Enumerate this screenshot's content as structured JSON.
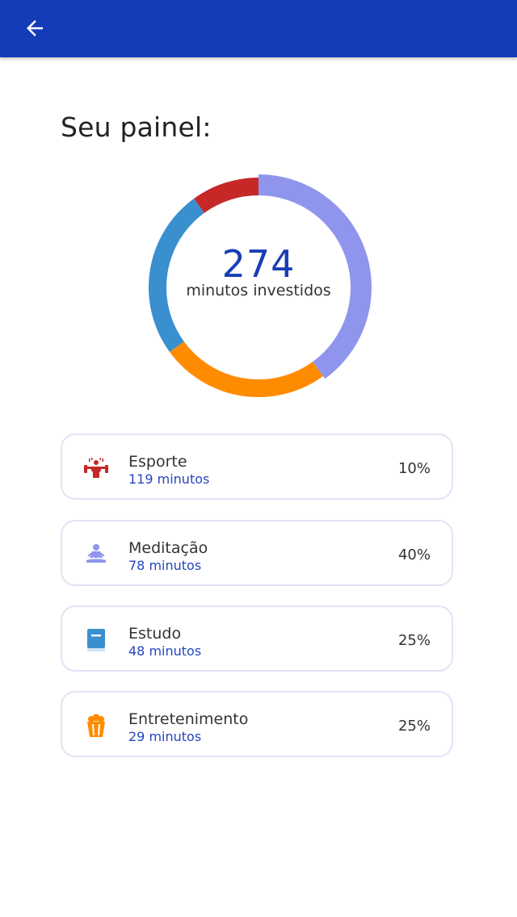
{
  "colors": {
    "appbar": "#143cb8",
    "accent": "#1a3db6",
    "sport": "#c62828",
    "meditation": "#8f95ec",
    "study": "#3a8fcf",
    "entertainment": "#ff8c00"
  },
  "header": {
    "back_icon": "arrow-back-icon"
  },
  "page": {
    "title": "Seu painel:"
  },
  "summary": {
    "total": "274",
    "label": "minutos investidos"
  },
  "chart_data": {
    "type": "pie",
    "categories": [
      "Esporte",
      "Meditação",
      "Estudo",
      "Entretenimento"
    ],
    "values": [
      10,
      40,
      25,
      25
    ],
    "segment_colors": {
      "Esporte": "#c62828",
      "Meditação": "#8f95ec",
      "Estudo": "#3a8fcf",
      "Entretenimento": "#ff8c00"
    }
  },
  "categories": [
    {
      "name": "Esporte",
      "minutes": "119 minutos",
      "percent": "10%",
      "icon": "weightlifter-icon",
      "color": "#c62828"
    },
    {
      "name": "Meditação",
      "minutes": "78 minutos",
      "percent": "40%",
      "icon": "meditation-icon",
      "color": "#8f95ec"
    },
    {
      "name": "Estudo",
      "minutes": "48 minutos",
      "percent": "25%",
      "icon": "book-icon",
      "color": "#3a8fcf"
    },
    {
      "name": "Entretenimento",
      "minutes": "29 minutos",
      "percent": "25%",
      "icon": "popcorn-icon",
      "color": "#ff8c00"
    }
  ]
}
